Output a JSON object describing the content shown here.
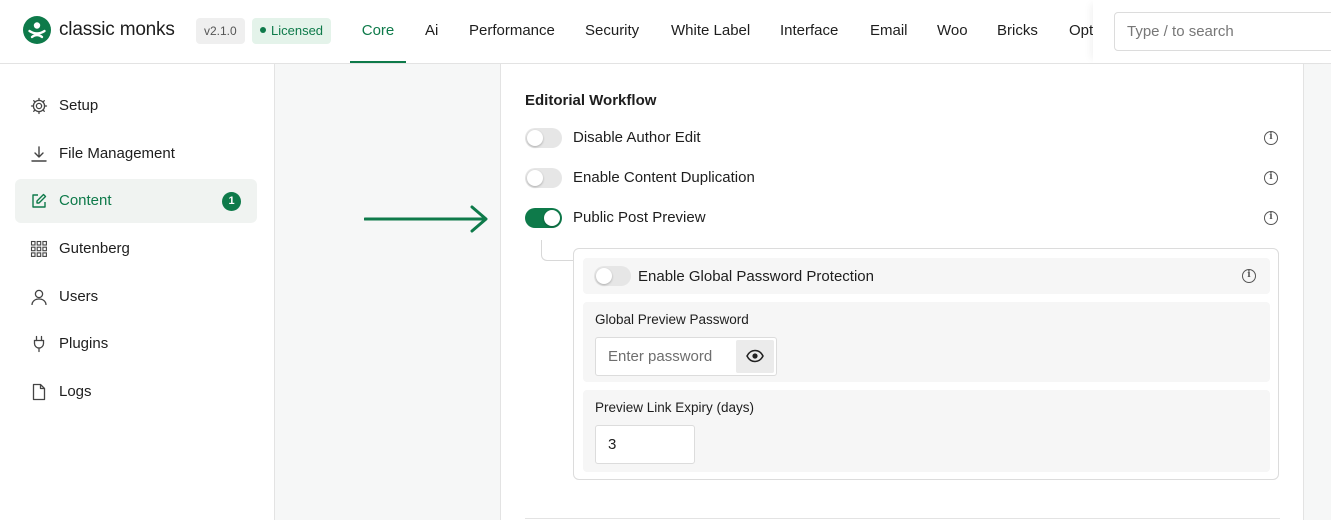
{
  "header": {
    "brand": "classic monks",
    "version": "v2.1.0",
    "license": "Licensed",
    "tabs": [
      "Core",
      "Ai",
      "Performance",
      "Security",
      "White Label",
      "Interface",
      "Email",
      "Woo",
      "Bricks",
      "Opt"
    ],
    "active_tab": "Core",
    "search_placeholder": "Type / to search"
  },
  "sidebar": {
    "items": [
      {
        "label": "Setup",
        "icon": "gear-icon"
      },
      {
        "label": "File Management",
        "icon": "download-icon"
      },
      {
        "label": "Content",
        "icon": "edit-icon",
        "badge": "1",
        "active": true
      },
      {
        "label": "Gutenberg",
        "icon": "grid-icon"
      },
      {
        "label": "Users",
        "icon": "user-icon"
      },
      {
        "label": "Plugins",
        "icon": "plug-icon"
      },
      {
        "label": "Logs",
        "icon": "file-icon"
      }
    ]
  },
  "panel": {
    "section_title": "Editorial Workflow",
    "settings": [
      {
        "label": "Disable Author Edit",
        "enabled": false
      },
      {
        "label": "Enable Content Duplication",
        "enabled": false
      },
      {
        "label": "Public Post Preview",
        "enabled": true
      }
    ],
    "sub_settings": {
      "global_password_toggle": {
        "label": "Enable Global Password Protection",
        "enabled": false
      },
      "password_field": {
        "label": "Global Preview Password",
        "placeholder": "Enter password",
        "value": ""
      },
      "expiry_field": {
        "label": "Preview Link Expiry (days)",
        "value": "3"
      }
    }
  },
  "colors": {
    "accent": "#0e7a4a",
    "badge_bg": "#0e7a4a",
    "licensed_bg": "#e4f3ea"
  }
}
